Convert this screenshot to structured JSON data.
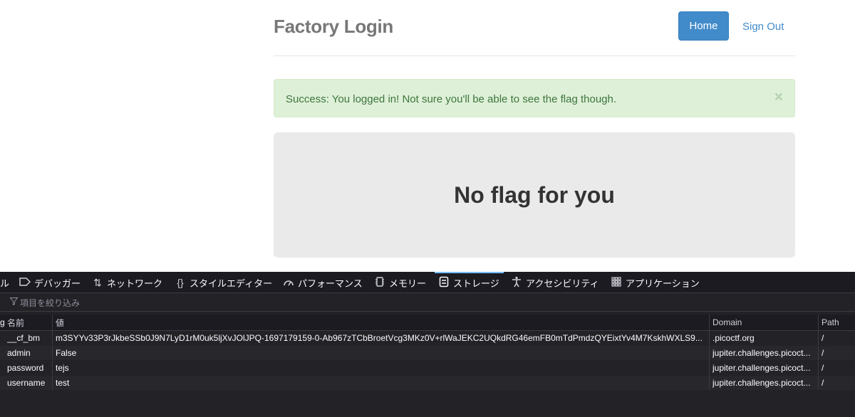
{
  "site": {
    "title": "Factory Login",
    "nav": {
      "home": "Home",
      "sign_out": "Sign Out"
    },
    "alert": {
      "message": "Success: You logged in! Not sure you'll be able to see the flag though.",
      "close": "×"
    },
    "jumbotron": "No flag for you"
  },
  "devtools": {
    "tabs": [
      {
        "label": "ル",
        "icon": ""
      },
      {
        "label": "デバッガー",
        "icon": "debugger-icon"
      },
      {
        "label": "ネットワーク",
        "icon": "network-icon"
      },
      {
        "label": "スタイルエディター",
        "icon": "style-editor-icon"
      },
      {
        "label": "パフォーマンス",
        "icon": "performance-icon"
      },
      {
        "label": "メモリー",
        "icon": "memory-icon"
      },
      {
        "label": "ストレージ",
        "icon": "storage-icon"
      },
      {
        "label": "アクセシビリティ",
        "icon": "accessibility-icon"
      },
      {
        "label": "アプリケーション",
        "icon": "application-icon"
      }
    ],
    "active_tab": "ストレージ",
    "filter_placeholder": "項目を絞り込み",
    "table": {
      "left_fragment": "g",
      "headers": {
        "name": "名前",
        "value": "値",
        "domain": "Domain",
        "path": "Path"
      },
      "rows": [
        {
          "name": "__cf_bm",
          "value": "m3SYYv33P3rJkbeSSb0J9N7LyD1rM0uk5ljXvJOlJPQ-1697179159-0-Ab967zTCbBroetVcg3MKz0V+rlWaJEKC2UQkdRG46emFB0mTdPmdzQYEixtYv4M7KskhWXLS9...",
          "domain": ".picoctf.org",
          "path": "/"
        },
        {
          "name": "admin",
          "value": "False",
          "domain": "jupiter.challenges.picoct...",
          "path": "/"
        },
        {
          "name": "password",
          "value": "tejs",
          "domain": "jupiter.challenges.picoct...",
          "path": "/"
        },
        {
          "name": "username",
          "value": "test",
          "domain": "jupiter.challenges.picoct...",
          "path": "/"
        }
      ]
    }
  }
}
